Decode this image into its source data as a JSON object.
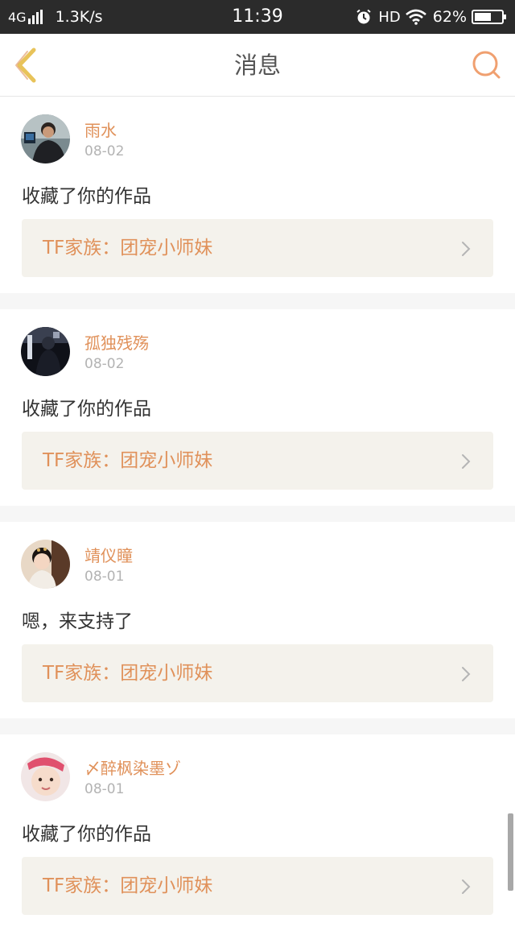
{
  "status_bar": {
    "network": "4G",
    "speed": "1.3K/s",
    "time": "11:39",
    "hd": "HD",
    "battery": "62%"
  },
  "header": {
    "title": "消息",
    "back_icon": "chevron-left-icon",
    "search_icon": "search-icon"
  },
  "colors": {
    "accent": "#e0915a",
    "back_icon": "#e8c35a",
    "link_bg": "#f4f2ec"
  },
  "messages": [
    {
      "username": "雨水",
      "date": "08-02",
      "text": "收藏了你的作品",
      "work": "TF家族：团宠小师妹"
    },
    {
      "username": "孤独残殇",
      "date": "08-02",
      "text": "收藏了你的作品",
      "work": "TF家族：团宠小师妹"
    },
    {
      "username": "靖仪瞳",
      "date": "08-01",
      "text": "嗯，来支持了",
      "work": "TF家族：团宠小师妹"
    },
    {
      "username": "〆醉枫染墨ゾ",
      "date": "08-01",
      "text": "收藏了你的作品",
      "work": "TF家族：团宠小师妹"
    }
  ]
}
